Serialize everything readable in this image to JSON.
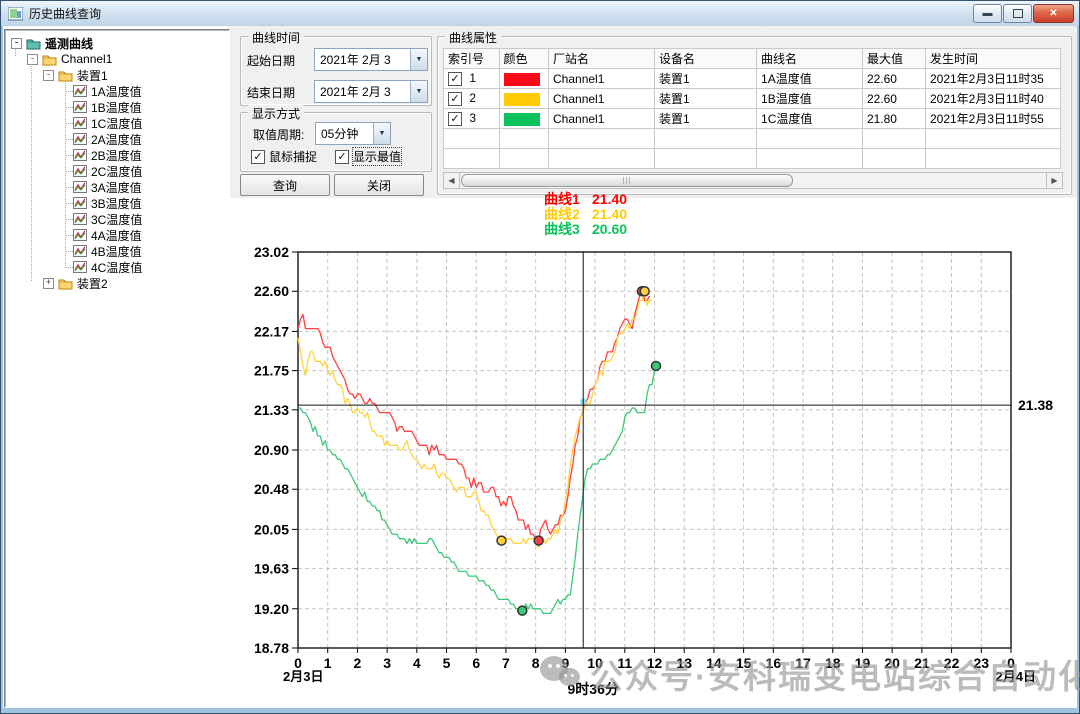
{
  "window": {
    "title": "历史曲线查询"
  },
  "tree": {
    "root": "遥测曲线",
    "channel": "Channel1",
    "device1": "装置1",
    "device2": "装置2",
    "leaves": [
      "1A温度值",
      "1B温度值",
      "1C温度值",
      "2A温度值",
      "2B温度值",
      "2C温度值",
      "3A温度值",
      "3B温度值",
      "3C温度值",
      "4A温度值",
      "4B温度值",
      "4C温度值"
    ]
  },
  "panel": {
    "time_group": {
      "title": "曲线时间",
      "start_label": "起始日期",
      "start_value": "2021年 2月 3",
      "end_label": "结束日期",
      "end_value": "2021年 2月 3"
    },
    "display_group": {
      "title": "显示方式",
      "period_label": "取值周期:",
      "period_value": "05分钟",
      "mouse_capture_label": "鼠标捕捉",
      "mouse_capture_checked": true,
      "show_extremes_label": "显示最值",
      "show_extremes_checked": true
    },
    "query_button": "查询",
    "close_button": "关闭"
  },
  "properties": {
    "title": "曲线属性",
    "headers": [
      "索引号",
      "颜色",
      "厂站名",
      "设备名",
      "曲线名",
      "最大值",
      "发生时间"
    ],
    "rows": [
      {
        "checked": true,
        "index": "1",
        "color": "#fd0a1a",
        "station": "Channel1",
        "device": "装置1",
        "curve": "1A温度值",
        "max": "22.60",
        "time": "2021年2月3日11时35"
      },
      {
        "checked": true,
        "index": "2",
        "color": "#ffcb05",
        "station": "Channel1",
        "device": "装置1",
        "curve": "1B温度值",
        "max": "22.60",
        "time": "2021年2月3日11时40"
      },
      {
        "checked": true,
        "index": "3",
        "color": "#0cc25c",
        "station": "Channel1",
        "device": "装置1",
        "curve": "1C温度值",
        "max": "21.80",
        "time": "2021年2月3日11时55"
      }
    ],
    "empty_rows": 2
  },
  "legend": [
    {
      "label": "曲线1",
      "value": "21.40",
      "color": "#ff0000"
    },
    {
      "label": "曲线2",
      "value": "21.40",
      "color": "#ffcb05"
    },
    {
      "label": "曲线3",
      "value": "20.60",
      "color": "#0cc25c"
    }
  ],
  "chart_data": {
    "type": "line",
    "ylim": [
      18.78,
      23.02
    ],
    "y_ticks": [
      23.02,
      22.6,
      22.17,
      21.75,
      21.33,
      20.9,
      20.48,
      20.05,
      19.63,
      19.2,
      18.78
    ],
    "x_hours": [
      0,
      1,
      2,
      3,
      4,
      5,
      6,
      7,
      8,
      9,
      10,
      11,
      12,
      13,
      14,
      15,
      16,
      17,
      18,
      19,
      20,
      21,
      22,
      23
    ],
    "x_end_label": "0",
    "x_range_hours": [
      0,
      24
    ],
    "date_left": "2月3日",
    "date_right": "2月4日",
    "grid": true,
    "quantize": 0.05,
    "crosshair": {
      "hour": 9.6,
      "hour_label": "9时36分",
      "value": 21.38,
      "value_label": "21.38"
    },
    "capture_marker": {
      "hour": 9.6,
      "value": 21.42,
      "color": "#86e4f6"
    },
    "series": [
      {
        "name": "曲线1",
        "color": "#ff4040",
        "jitter": 0.055,
        "end_hour": 11.9,
        "max_marker": {
          "hour": 11.58,
          "value": 22.6
        },
        "min_marker": {
          "hour": 8.1,
          "value": 19.93
        },
        "keypoints": [
          [
            0,
            22.25
          ],
          [
            0.15,
            22.32
          ],
          [
            0.4,
            22.18
          ],
          [
            0.6,
            22.22
          ],
          [
            0.8,
            22.1
          ],
          [
            1,
            22.0
          ],
          [
            1.3,
            21.8
          ],
          [
            1.6,
            21.6
          ],
          [
            1.9,
            21.5
          ],
          [
            2.2,
            21.45
          ],
          [
            2.5,
            21.42
          ],
          [
            2.8,
            21.3
          ],
          [
            3.1,
            21.28
          ],
          [
            3.4,
            21.12
          ],
          [
            3.7,
            21.18
          ],
          [
            4,
            20.98
          ],
          [
            4.3,
            20.9
          ],
          [
            4.6,
            20.92
          ],
          [
            5,
            20.78
          ],
          [
            5.3,
            20.78
          ],
          [
            5.6,
            20.65
          ],
          [
            6,
            20.52
          ],
          [
            6.3,
            20.48
          ],
          [
            6.6,
            20.5
          ],
          [
            6.9,
            20.3
          ],
          [
            7.2,
            20.35
          ],
          [
            7.5,
            20.15
          ],
          [
            7.8,
            20.05
          ],
          [
            8.1,
            19.93
          ],
          [
            8.35,
            20.15
          ],
          [
            8.55,
            20.0
          ],
          [
            8.75,
            20.1
          ],
          [
            8.95,
            20.2
          ],
          [
            9.15,
            20.55
          ],
          [
            9.35,
            21.0
          ],
          [
            9.55,
            21.3
          ],
          [
            9.66,
            21.4
          ],
          [
            9.85,
            21.5
          ],
          [
            10,
            21.65
          ],
          [
            10.3,
            21.85
          ],
          [
            10.6,
            22.0
          ],
          [
            10.85,
            22.25
          ],
          [
            11.05,
            22.3
          ],
          [
            11.25,
            22.25
          ],
          [
            11.4,
            22.45
          ],
          [
            11.58,
            22.6
          ],
          [
            11.75,
            22.52
          ],
          [
            11.9,
            22.58
          ]
        ]
      },
      {
        "name": "曲线2",
        "color": "#ffd23e",
        "jitter": 0.05,
        "end_hour": 11.95,
        "max_marker": {
          "hour": 11.67,
          "value": 22.6
        },
        "min_marker": {
          "hour": 6.85,
          "value": 19.93
        },
        "keypoints": [
          [
            0,
            22.08
          ],
          [
            0.25,
            21.72
          ],
          [
            0.45,
            21.95
          ],
          [
            0.7,
            21.85
          ],
          [
            1,
            21.78
          ],
          [
            1.3,
            21.62
          ],
          [
            1.6,
            21.45
          ],
          [
            1.9,
            21.3
          ],
          [
            2.2,
            21.32
          ],
          [
            2.5,
            21.15
          ],
          [
            2.8,
            21.0
          ],
          [
            3.1,
            20.95
          ],
          [
            3.4,
            20.9
          ],
          [
            3.7,
            20.95
          ],
          [
            4,
            20.78
          ],
          [
            4.3,
            20.72
          ],
          [
            4.6,
            20.68
          ],
          [
            5,
            20.58
          ],
          [
            5.3,
            20.52
          ],
          [
            5.6,
            20.45
          ],
          [
            6,
            20.38
          ],
          [
            6.3,
            20.22
          ],
          [
            6.6,
            20.05
          ],
          [
            6.85,
            19.93
          ],
          [
            7.1,
            19.93
          ],
          [
            7.4,
            19.9
          ],
          [
            7.7,
            19.93
          ],
          [
            8,
            19.9
          ],
          [
            8.3,
            19.93
          ],
          [
            8.55,
            20.0
          ],
          [
            8.8,
            20.05
          ],
          [
            9,
            20.3
          ],
          [
            9.2,
            20.8
          ],
          [
            9.4,
            21.1
          ],
          [
            9.55,
            21.3
          ],
          [
            9.66,
            21.4
          ],
          [
            9.85,
            21.45
          ],
          [
            10,
            21.6
          ],
          [
            10.3,
            21.8
          ],
          [
            10.6,
            21.95
          ],
          [
            10.85,
            22.1
          ],
          [
            11.05,
            22.2
          ],
          [
            11.25,
            22.3
          ],
          [
            11.45,
            22.4
          ],
          [
            11.67,
            22.6
          ],
          [
            11.8,
            22.45
          ],
          [
            11.95,
            22.55
          ]
        ]
      },
      {
        "name": "曲线3",
        "color": "#3dc878",
        "jitter": 0.035,
        "end_hour": 12.05,
        "max_marker": {
          "hour": 12.05,
          "value": 21.8
        },
        "min_marker": {
          "hour": 7.55,
          "value": 19.18
        },
        "keypoints": [
          [
            0,
            21.38
          ],
          [
            0.2,
            21.3
          ],
          [
            0.5,
            21.15
          ],
          [
            0.8,
            21.0
          ],
          [
            1.2,
            20.85
          ],
          [
            1.6,
            20.7
          ],
          [
            2,
            20.5
          ],
          [
            2.4,
            20.35
          ],
          [
            2.8,
            20.2
          ],
          [
            3.2,
            20.0
          ],
          [
            3.6,
            19.92
          ],
          [
            4,
            19.9
          ],
          [
            4.4,
            19.95
          ],
          [
            4.8,
            19.78
          ],
          [
            5.2,
            19.68
          ],
          [
            5.6,
            19.6
          ],
          [
            6,
            19.55
          ],
          [
            6.4,
            19.42
          ],
          [
            6.8,
            19.32
          ],
          [
            7.1,
            19.28
          ],
          [
            7.4,
            19.2
          ],
          [
            7.55,
            19.18
          ],
          [
            7.8,
            19.22
          ],
          [
            8.1,
            19.18
          ],
          [
            8.4,
            19.15
          ],
          [
            8.7,
            19.25
          ],
          [
            9,
            19.3
          ],
          [
            9.15,
            19.35
          ],
          [
            9.35,
            19.8
          ],
          [
            9.5,
            20.2
          ],
          [
            9.66,
            20.6
          ],
          [
            9.8,
            20.7
          ],
          [
            10,
            20.76
          ],
          [
            10.3,
            20.8
          ],
          [
            10.6,
            20.9
          ],
          [
            10.9,
            21.1
          ],
          [
            11.1,
            21.32
          ],
          [
            11.35,
            21.35
          ],
          [
            11.5,
            21.28
          ],
          [
            11.65,
            21.3
          ],
          [
            11.78,
            21.55
          ],
          [
            11.9,
            21.6
          ],
          [
            12.05,
            21.8
          ]
        ]
      }
    ]
  },
  "watermark": {
    "text": "公众号·安科瑞变电站综合自动化"
  }
}
